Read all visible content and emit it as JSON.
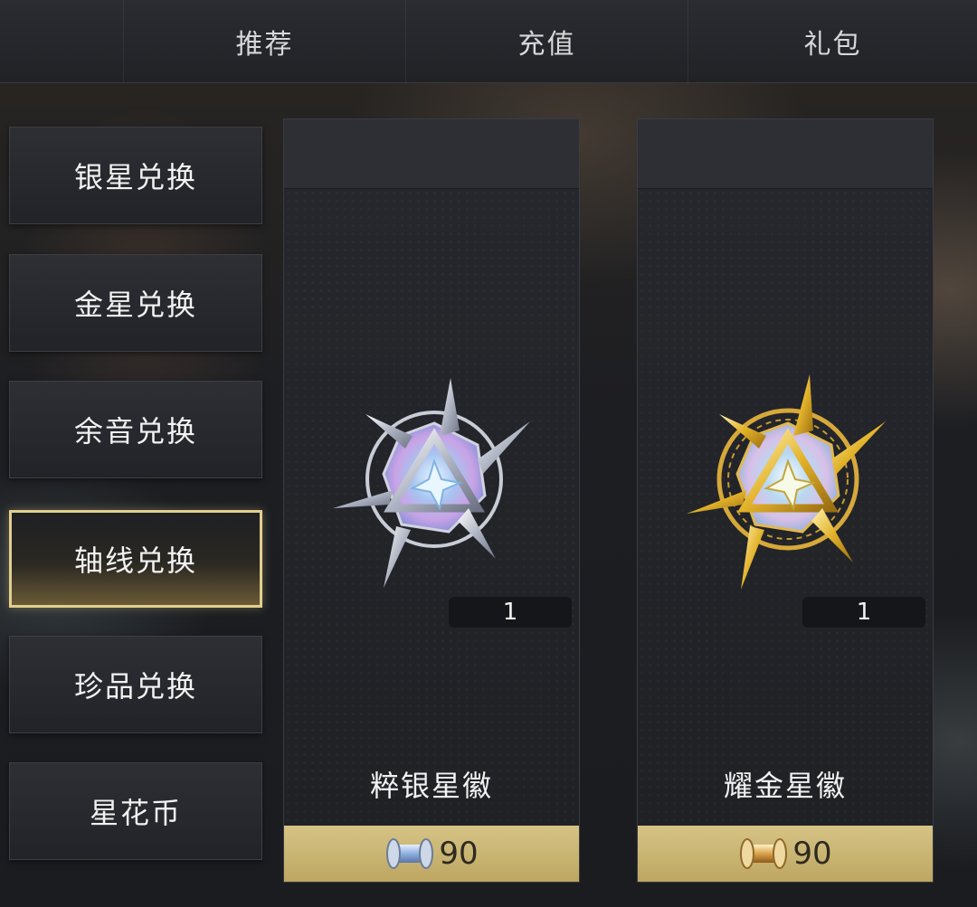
{
  "tabs": [
    "推荐",
    "充值",
    "礼包"
  ],
  "sidebar": {
    "items": [
      {
        "label": "银星兑换"
      },
      {
        "label": "金星兑换"
      },
      {
        "label": "余音兑换"
      },
      {
        "label": "轴线兑换"
      },
      {
        "label": "珍品兑换"
      },
      {
        "label": "星花币"
      }
    ],
    "active_index": 3
  },
  "products": [
    {
      "name": "粹银星徽",
      "quantity": "1",
      "price": "90",
      "currency_icon": "silver-spool-icon",
      "item_icon": "silver-star-badge-icon"
    },
    {
      "name": "耀金星徽",
      "quantity": "1",
      "price": "90",
      "currency_icon": "gold-spool-icon",
      "item_icon": "gold-star-badge-icon"
    }
  ],
  "colors": {
    "accent_gold": "#e2cf8e",
    "price_bar": "#cbb772",
    "panel": "#24262b"
  }
}
